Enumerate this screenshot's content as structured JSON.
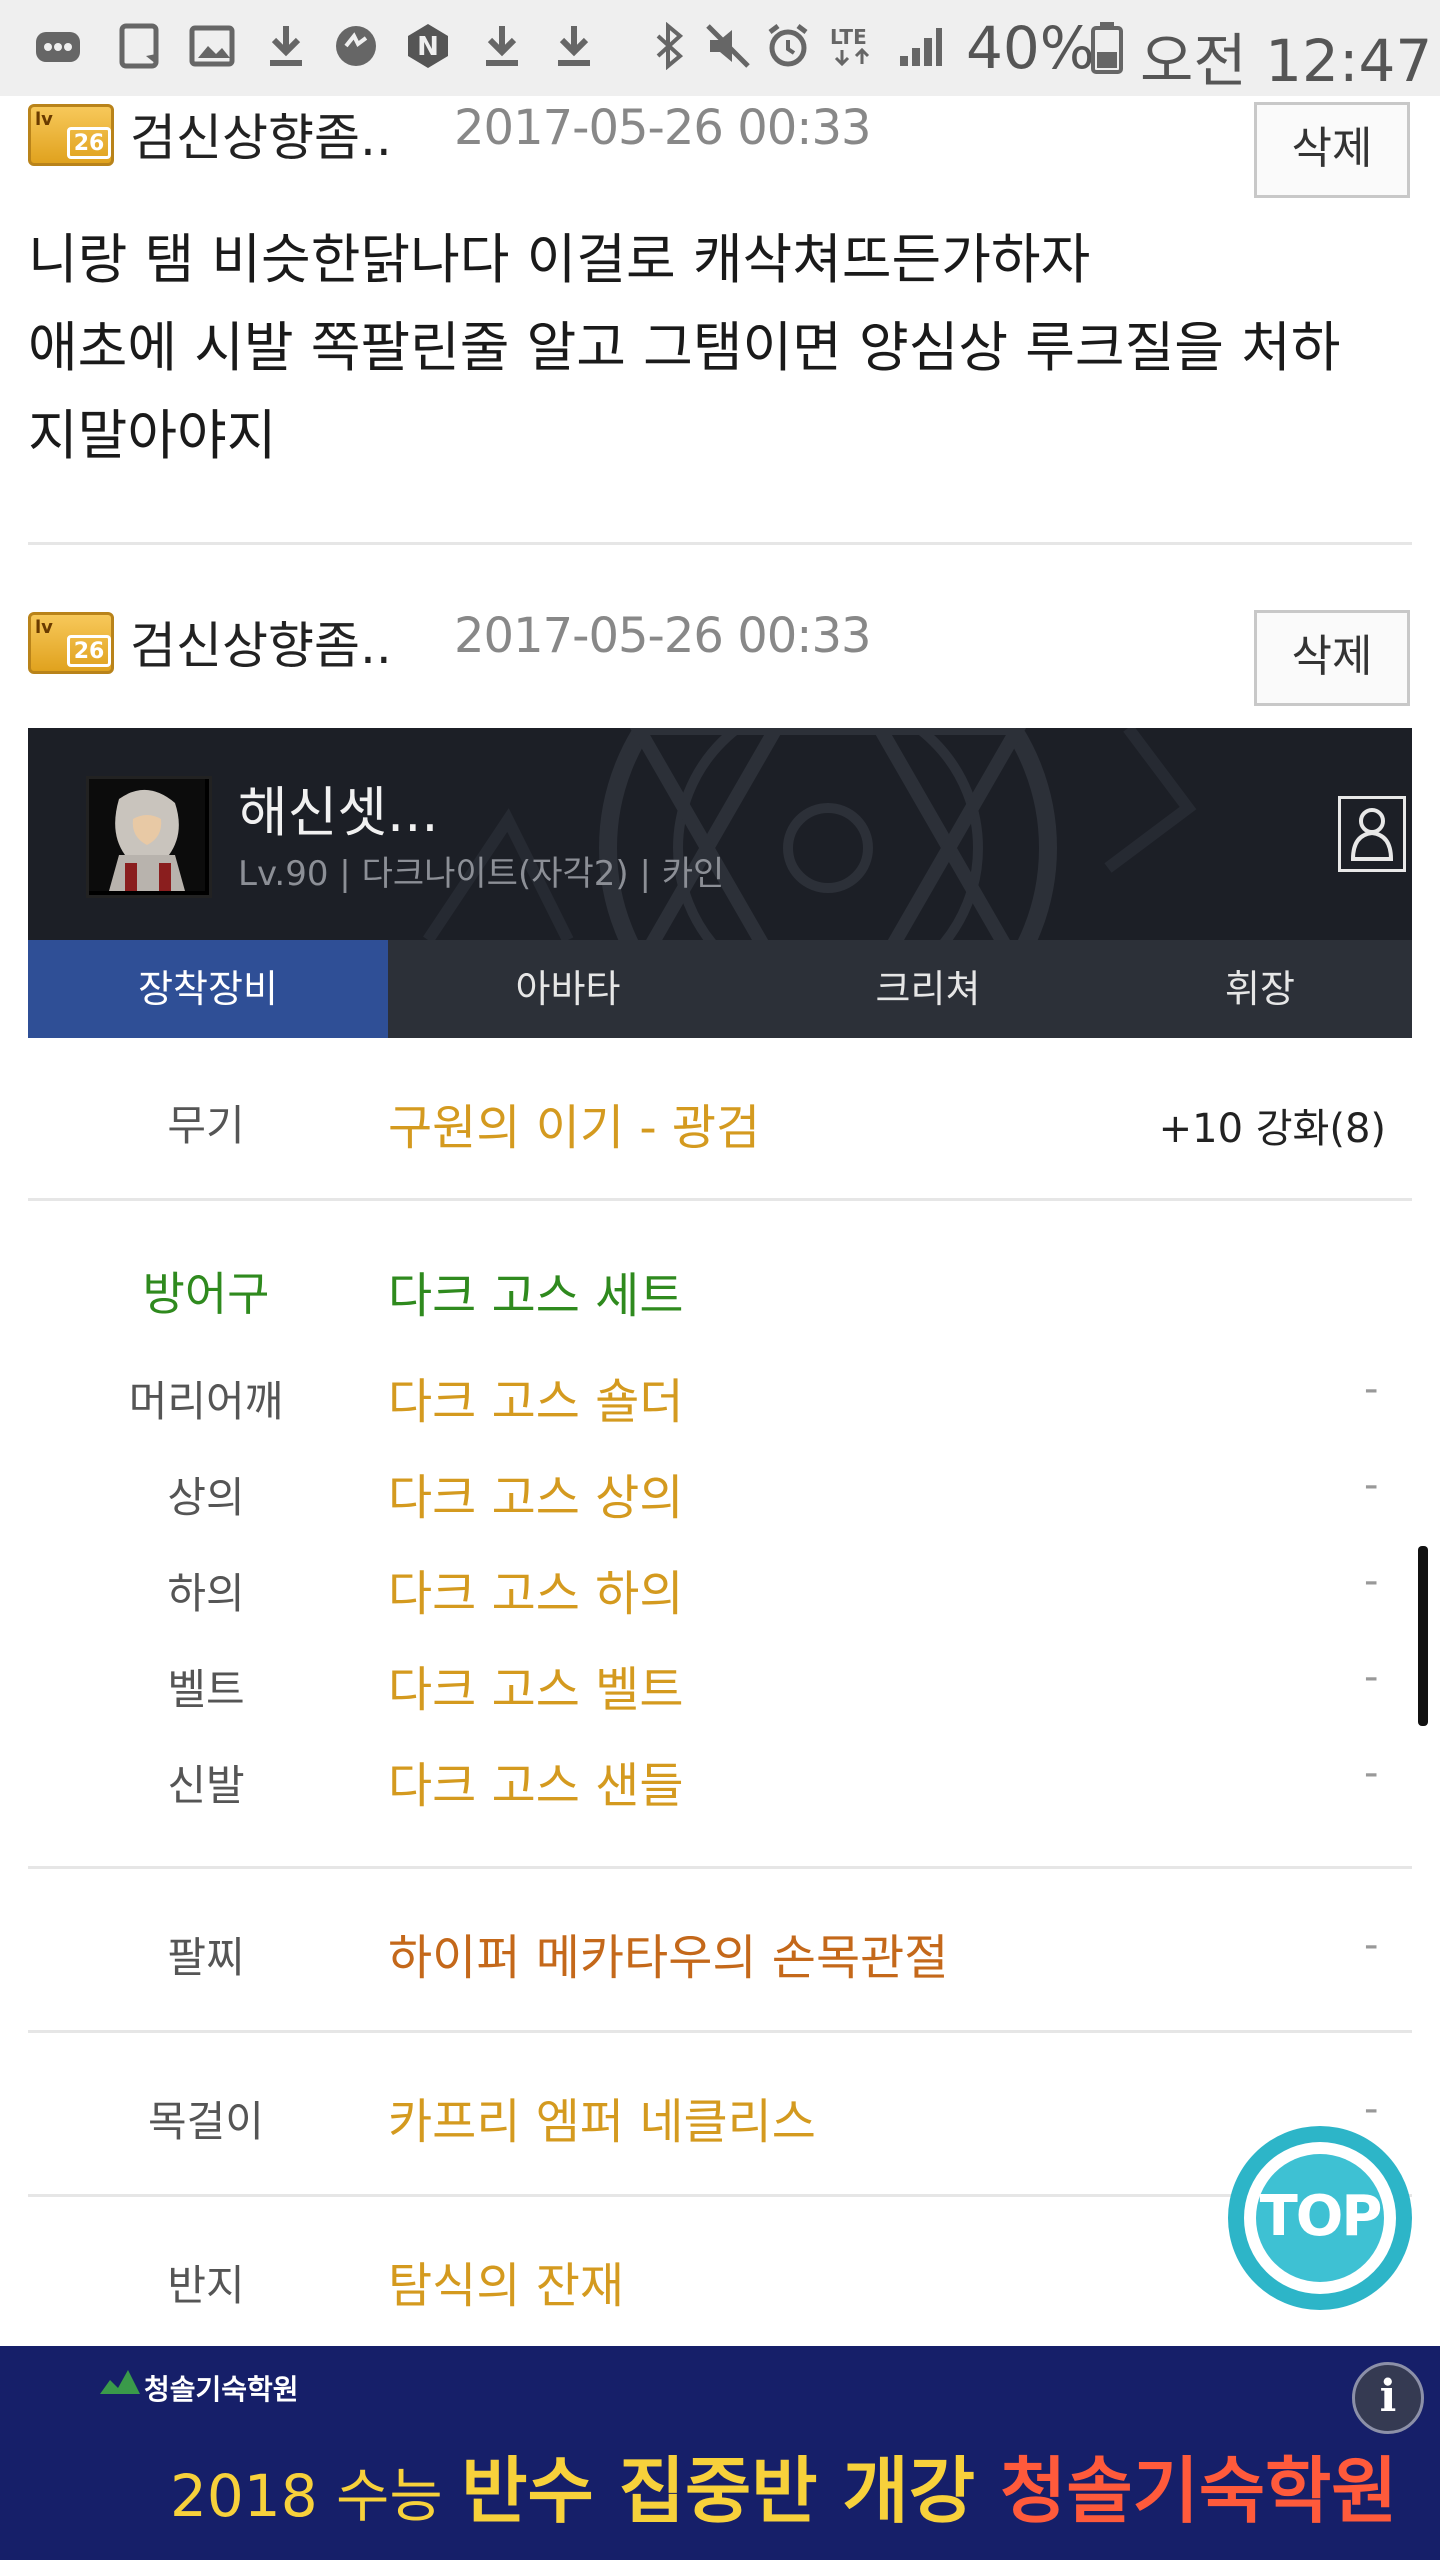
{
  "status_bar": {
    "battery": "40%",
    "time": "오전 12:47",
    "network": "LTE"
  },
  "comments": [
    {
      "level": "26",
      "nickname": "검신상향좀..",
      "date": "2017-05-26 00:33",
      "delete_label": "삭제",
      "text_lines": [
        "니랑 탬 비슷한닭나다 이걸로 캐삭쳐뜨든가하자",
        "애초에 시발 쪽팔린줄 알고 그탬이면 양심상 루크질을 처하",
        "지말아야지"
      ]
    },
    {
      "level": "26",
      "nickname": "검신상향좀..",
      "date": "2017-05-26 00:33",
      "delete_label": "삭제"
    }
  ],
  "character": {
    "name": "해신셋...",
    "info": "Lv.90 | 다크나이트(자각2) | 카인"
  },
  "tabs": [
    {
      "label": "장착장비",
      "active": true
    },
    {
      "label": "아바타",
      "active": false
    },
    {
      "label": "크리쳐",
      "active": false
    },
    {
      "label": "휘장",
      "active": false
    }
  ],
  "equipment": {
    "weapon": {
      "label": "무기",
      "item": "구원의 이기 - 광검",
      "value": "+10 강화(8)"
    },
    "armor_label": "방어구",
    "armor_set": "다크 고스 세트",
    "armor": [
      {
        "label": "머리어깨",
        "item": "다크 고스 숄더",
        "value": "-"
      },
      {
        "label": "상의",
        "item": "다크 고스 상의",
        "value": "-"
      },
      {
        "label": "하의",
        "item": "다크 고스 하의",
        "value": "-"
      },
      {
        "label": "벨트",
        "item": "다크 고스 벨트",
        "value": "-"
      },
      {
        "label": "신발",
        "item": "다크 고스 샌들",
        "value": "-"
      }
    ],
    "bracelet": {
      "label": "팔찌",
      "item": "하이퍼 메카타우의 손목관절",
      "value": "-"
    },
    "necklace": {
      "label": "목걸이",
      "item": "카프리 엠퍼 네클리스",
      "value": "-"
    },
    "ring": {
      "label": "반지",
      "item": "탐식의 잔재"
    }
  },
  "top_button": "TOP",
  "ad": {
    "logo": "청솔기숙학원",
    "part1": "2018 수능 ",
    "part2": "반수 집중반 개강 ",
    "part3": "청솔기숙학원",
    "info_icon": "i"
  },
  "colors": {
    "tab_active": "#2f4f96",
    "item_rare": "#d49a1f",
    "item_unique": "#c4681a",
    "set_green": "#2f8a1e",
    "top_button": "#2db5c8",
    "ad_bg": "#161f69"
  }
}
